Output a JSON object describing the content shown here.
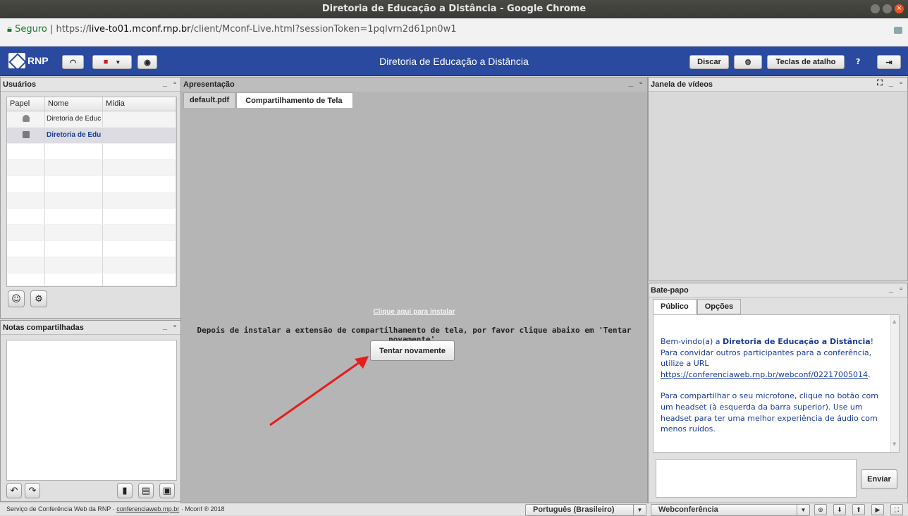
{
  "browser": {
    "window_title": "Diretoria de Educação a Distância - Google Chrome",
    "secure_label": "Seguro",
    "url_scheme": "https://",
    "url_host": "live-to01.mconf.rnp.br",
    "url_path": "/client/Mconf-Live.html?sessionToken=1pqlvrn2d61pn0w1"
  },
  "appbar": {
    "logo_text": "RNP",
    "title": "Diretoria de Educação a Distância",
    "dial_label": "Discar",
    "shortcuts_label": "Teclas de atalho",
    "help_label": "?"
  },
  "users": {
    "title": "Usuários",
    "columns": [
      "Papel",
      "Nome",
      "Mídia"
    ],
    "rows": [
      {
        "role": "viewer",
        "name": "Diretoria de Educ"
      },
      {
        "role": "presenter",
        "name": "Diretoria de Edu"
      }
    ]
  },
  "notes": {
    "title": "Notas compartilhadas"
  },
  "presentation": {
    "title": "Apresentação",
    "tabs": [
      "default.pdf",
      "Compartilhamento de Tela"
    ],
    "install_link": "Clique aqui para instalar",
    "install_message": "Depois de instalar a extensão de compartilhamento de tela, por favor clique abaixo em 'Tentar novamente'.",
    "retry_label": "Tentar novamente"
  },
  "video": {
    "title": "Janela de vídeos"
  },
  "chat": {
    "title": "Bate-papo",
    "tabs": [
      "Público",
      "Opções"
    ],
    "welcome_prefix": "Bem-vindo(a) a ",
    "welcome_room": "Diretoria de Educação a Distância",
    "welcome_suffix": "!",
    "invite_text": "Para convidar outros participantes para a conferência, utilize a URL",
    "invite_url": "https://conferenciaweb.rnp.br/webconf/02217005014",
    "invite_url_end": ".",
    "mic_text": "Para compartilhar o seu microfone, clique no botão com um headset (à esquerda da barra superior). Use um headset para ter uma melhor experiência de áudio com menos ruídos.",
    "send_label": "Enviar"
  },
  "footer": {
    "service_text": "Serviço de Conferência Web da RNP · ",
    "service_link": "conferenciaweb.rnp.br",
    "copyright": " · Mconf ® 2018",
    "language": "Português (Brasileiro)",
    "layout": "Webconferência"
  },
  "colors": {
    "appbar": "#2a4aa0",
    "chat_text": "#1a3d9c",
    "arrow": "#e81c1c"
  }
}
